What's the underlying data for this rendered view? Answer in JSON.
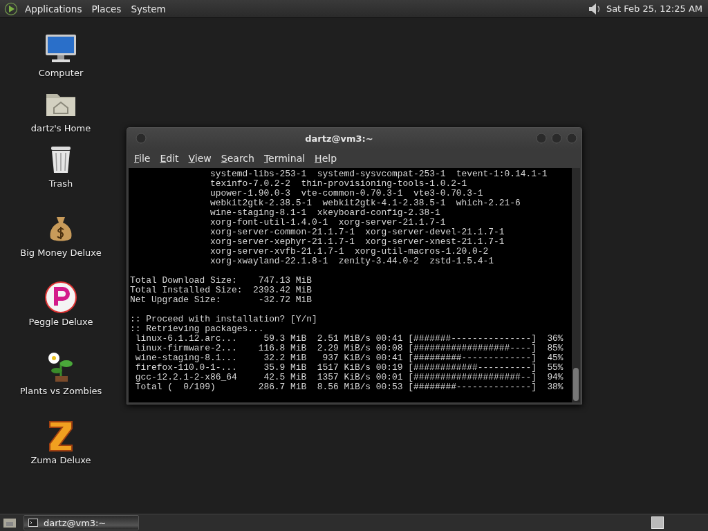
{
  "top_panel": {
    "menus": [
      "Applications",
      "Places",
      "System"
    ],
    "clock": "Sat Feb 25, 12:25 AM"
  },
  "desktop_icons": [
    {
      "kind": "computer",
      "label": "Computer"
    },
    {
      "kind": "home",
      "label": "dartz's Home"
    },
    {
      "kind": "trash",
      "label": "Trash"
    },
    {
      "kind": "money",
      "label": "Big Money Deluxe"
    },
    {
      "kind": "peggle",
      "label": "Peggle Deluxe"
    },
    {
      "kind": "plants",
      "label": "Plants vs Zombies"
    },
    {
      "kind": "zuma",
      "label": "Zuma Deluxe"
    }
  ],
  "window": {
    "title": "dartz@vm3:~",
    "menu": [
      "File",
      "Edit",
      "View",
      "Search",
      "Terminal",
      "Help"
    ],
    "terminal": {
      "package_lines": [
        "systemd-libs-253-1  systemd-sysvcompat-253-1  tevent-1:0.14.1-1",
        "texinfo-7.0.2-2  thin-provisioning-tools-1.0.2-1",
        "upower-1.90.0-3  vte-common-0.70.3-1  vte3-0.70.3-1",
        "webkit2gtk-2.38.5-1  webkit2gtk-4.1-2.38.5-1  which-2.21-6",
        "wine-staging-8.1-1  xkeyboard-config-2.38-1",
        "xorg-font-util-1.4.0-1  xorg-server-21.1.7-1",
        "xorg-server-common-21.1.7-1  xorg-server-devel-21.1.7-1",
        "xorg-server-xephyr-21.1.7-1  xorg-server-xnest-21.1.7-1",
        "xorg-server-xvfb-21.1.7-1  xorg-util-macros-1.20.0-2",
        "xorg-xwayland-22.1.8-1  zenity-3.44.0-2  zstd-1.5.4-1"
      ],
      "summary_lines": [
        "Total Download Size:    747.13 MiB",
        "Total Installed Size:  2393.42 MiB",
        "Net Upgrade Size:       -32.72 MiB"
      ],
      "output_lines": [
        ":: Proceed with installation? [Y/n]",
        ":: Retrieving packages...",
        " linux-6.1.12.arc...     59.3 MiB  2.51 MiB/s 00:41 [#######---------------]  36%",
        " linux-firmware-2...    116.8 MiB  2.29 MiB/s 00:08 [##################----]  85%",
        " wine-staging-8.1...     32.2 MiB   937 KiB/s 00:41 [#########-------------]  45%",
        " firefox-110.0-1-...     35.9 MiB  1517 KiB/s 00:19 [############----------]  55%",
        " gcc-12.2.1-2-x86_64     42.5 MiB  1357 KiB/s 00:01 [####################--]  94%",
        " Total (  0/109)        286.7 MiB  8.56 MiB/s 00:53 [########--------------]  38%"
      ]
    }
  },
  "taskbar": {
    "tasks": [
      {
        "label": "dartz@vm3:~",
        "selected": true
      }
    ]
  }
}
